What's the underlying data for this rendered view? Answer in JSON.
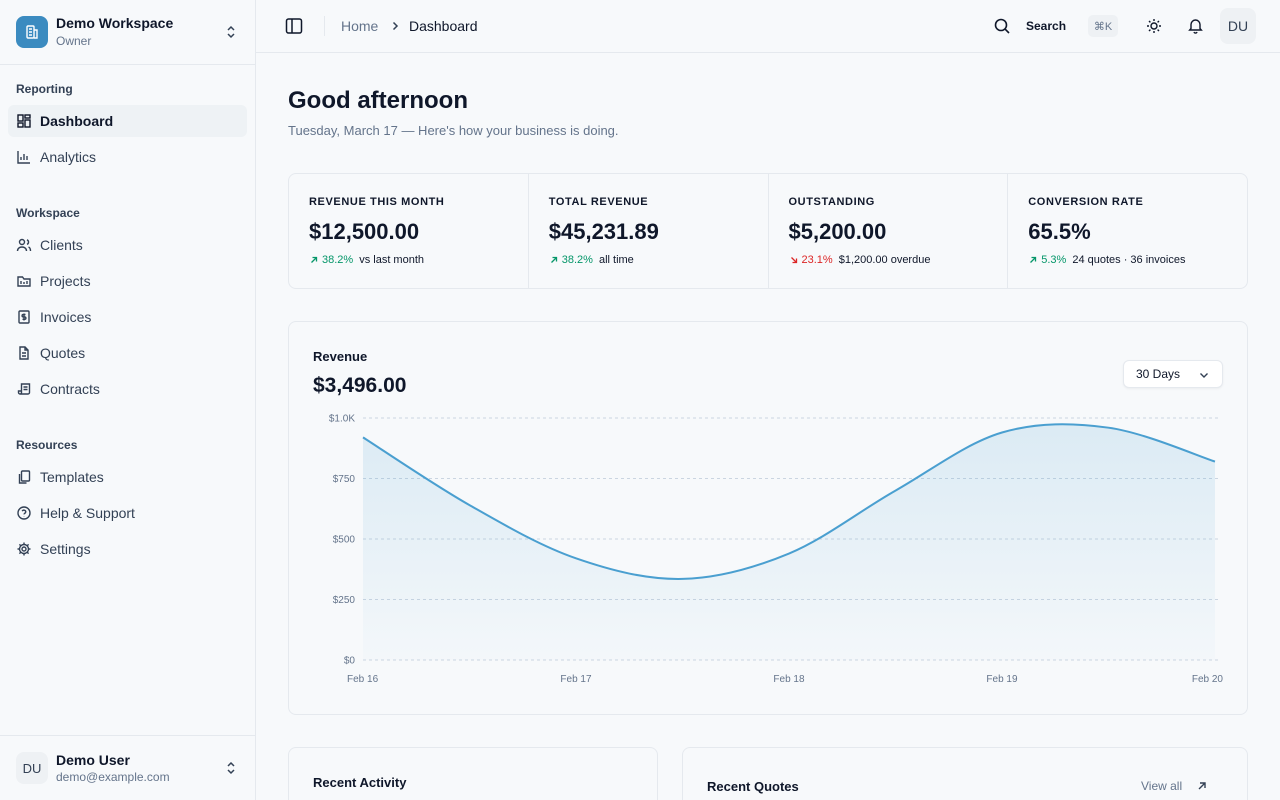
{
  "sidebar": {
    "workspace": {
      "name": "Demo Workspace",
      "role": "Owner"
    },
    "groups": [
      {
        "label": "Reporting",
        "items": [
          {
            "label": "Dashboard",
            "icon": "dashboard-icon",
            "active": true
          },
          {
            "label": "Analytics",
            "icon": "bar-chart-icon"
          }
        ]
      },
      {
        "label": "Workspace",
        "items": [
          {
            "label": "Clients",
            "icon": "users-icon"
          },
          {
            "label": "Projects",
            "icon": "folder-icon"
          },
          {
            "label": "Invoices",
            "icon": "invoice-icon"
          },
          {
            "label": "Quotes",
            "icon": "file-text-icon"
          },
          {
            "label": "Contracts",
            "icon": "scroll-icon"
          }
        ]
      },
      {
        "label": "Resources",
        "items": [
          {
            "label": "Templates",
            "icon": "copy-icon"
          },
          {
            "label": "Help & Support",
            "icon": "help-icon"
          },
          {
            "label": "Settings",
            "icon": "gear-icon"
          }
        ]
      }
    ],
    "user": {
      "initials": "DU",
      "name": "Demo User",
      "email": "demo@example.com"
    }
  },
  "topbar": {
    "breadcrumb": {
      "home": "Home",
      "current": "Dashboard"
    },
    "search_label": "Search",
    "shortcut": "⌘K",
    "avatar_initials": "DU"
  },
  "main": {
    "greeting": "Good afternoon",
    "subtitle": "Tuesday, March 17 — Here's how your business is doing.",
    "kpis": [
      {
        "label": "REVENUE THIS MONTH",
        "value": "$12,500.00",
        "trend": "up",
        "change": "38.2%",
        "note": "vs last month"
      },
      {
        "label": "TOTAL REVENUE",
        "value": "$45,231.89",
        "trend": "up",
        "change": "38.2%",
        "note": "all time"
      },
      {
        "label": "OUTSTANDING",
        "value": "$5,200.00",
        "trend": "down",
        "change": "23.1%",
        "note": "$1,200.00 overdue"
      },
      {
        "label": "CONVERSION RATE",
        "value": "65.5%",
        "trend": "up",
        "change": "5.3%",
        "note": "24 quotes · 36 invoices"
      }
    ],
    "revenue_card": {
      "title": "Revenue",
      "total": "$3,496.00",
      "range": "30 Days"
    },
    "recent_activity": {
      "title": "Recent Activity"
    },
    "recent_quotes": {
      "title": "Recent Quotes",
      "view_all": "View all"
    }
  },
  "colors": {
    "accent": "#3b8bc0",
    "line": "#4a9fd0",
    "up": "#059669",
    "down": "#dc2626"
  },
  "chart_data": {
    "type": "area",
    "x": [
      "Feb 16",
      "Feb 17",
      "Feb 18",
      "Feb 19",
      "Feb 20"
    ],
    "y_ticks": [
      "$0",
      "$250",
      "$500",
      "$750",
      "$1.0K"
    ],
    "ylim": [
      0,
      1000
    ],
    "series": [
      {
        "x": [
          0,
          0.5,
          1,
          1.5,
          2,
          2.5,
          3,
          3.5,
          4
        ],
        "values": [
          920,
          640,
          420,
          335,
          440,
          700,
          940,
          960,
          820
        ]
      }
    ],
    "grid": true
  }
}
